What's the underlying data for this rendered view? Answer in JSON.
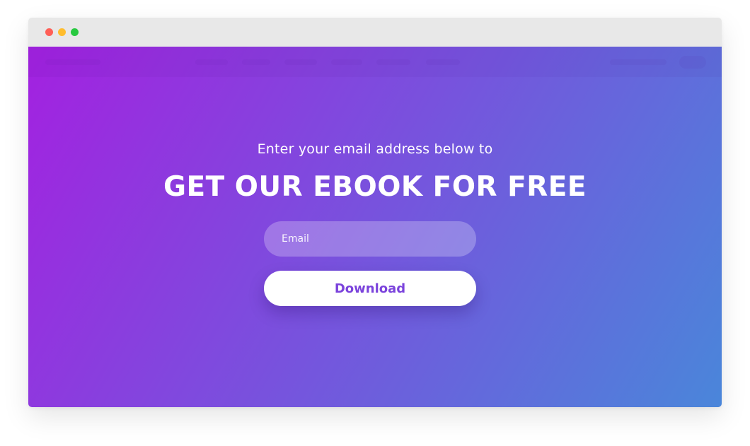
{
  "window": {
    "controls": [
      {
        "name": "close",
        "color": "#ff5f57"
      },
      {
        "name": "minimize",
        "color": "#ffbd2e"
      },
      {
        "name": "maximize",
        "color": "#28c940"
      }
    ]
  },
  "hero": {
    "background_gradient_start": "#a321e0",
    "background_gradient_end": "#4a86da",
    "subtitle": "Enter your email address below to",
    "headline": "GET OUR EBOOK FOR FREE",
    "email_placeholder": "Email",
    "email_value": "",
    "email_field_background": "rgba(255,255,255,0.25)",
    "download_label": "Download",
    "download_text_color": "#7b43dc"
  }
}
